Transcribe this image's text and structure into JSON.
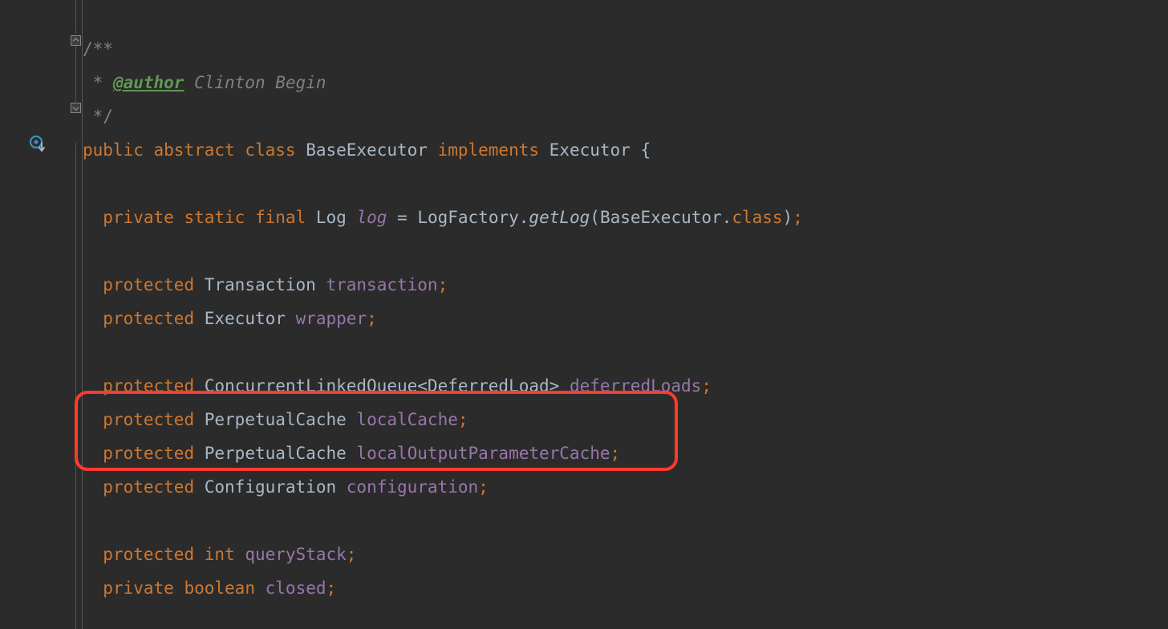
{
  "code": {
    "docOpen": "/**",
    "docStar": " * ",
    "docTag": "@author",
    "docAuthor": " Clinton Begin",
    "docClose": " */",
    "kw_public": "public",
    "kw_abstract": "abstract",
    "kw_class": "class",
    "className": "BaseExecutor",
    "kw_implements": "implements",
    "iface": "Executor",
    "brace_open": "{",
    "kw_private": "private",
    "kw_static": "static",
    "kw_final": "final",
    "type_Log": "Log",
    "field_log": "log",
    "eq": " = ",
    "LogFactory": "LogFactory",
    "dot": ".",
    "getLog": "getLog",
    "lparen": "(",
    "BaseExecutor2": "BaseExecutor",
    "kw_class_token": "class",
    "rparen": ")",
    "semi": ";",
    "kw_protected": "protected",
    "type_Transaction": "Transaction",
    "field_transaction": "transaction",
    "type_Executor": "Executor",
    "field_wrapper": "wrapper",
    "type_CLQ": "ConcurrentLinkedQueue",
    "lt": "<",
    "type_DeferredLoad": "DeferredLoad",
    "gt": ">",
    "field_deferredLoads": "deferredLoads",
    "type_PerpetualCache": "PerpetualCache",
    "field_localCache": "localCache",
    "field_localOutputParameterCache": "localOutputParameterCache",
    "type_Configuration": "Configuration",
    "field_configuration": "configuration",
    "kw_int": "int",
    "field_queryStack": "queryStack",
    "kw_boolean": "boolean",
    "field_closed": "closed"
  },
  "annotations": {
    "highlight_lines": [
      "line-localCache",
      "line-localOutputParameterCache"
    ]
  }
}
